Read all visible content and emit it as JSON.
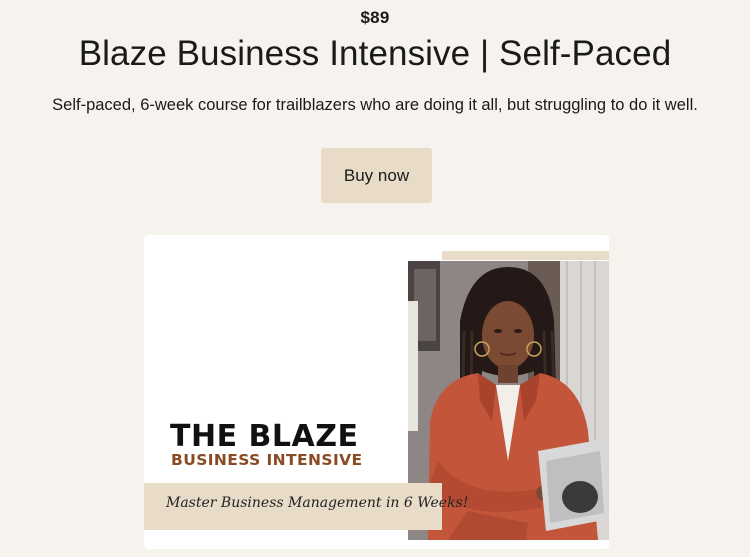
{
  "product": {
    "price": "$89",
    "title": "Blaze Business Intensive | Self-Paced",
    "description": "Self-paced, 6-week course for trailblazers who are doing it all, but struggling to do it well.",
    "buy_label": "Buy now"
  },
  "cover": {
    "heading": "THE BLAZE",
    "subheading": "BUSINESS INTENSIVE",
    "tagline": "Master Business Management in 6 Weeks!"
  },
  "colors": {
    "background": "#f6f3ee",
    "button": "#e8dcc8",
    "accent_brown": "#8a4a22",
    "blazer": "#c2553a"
  }
}
